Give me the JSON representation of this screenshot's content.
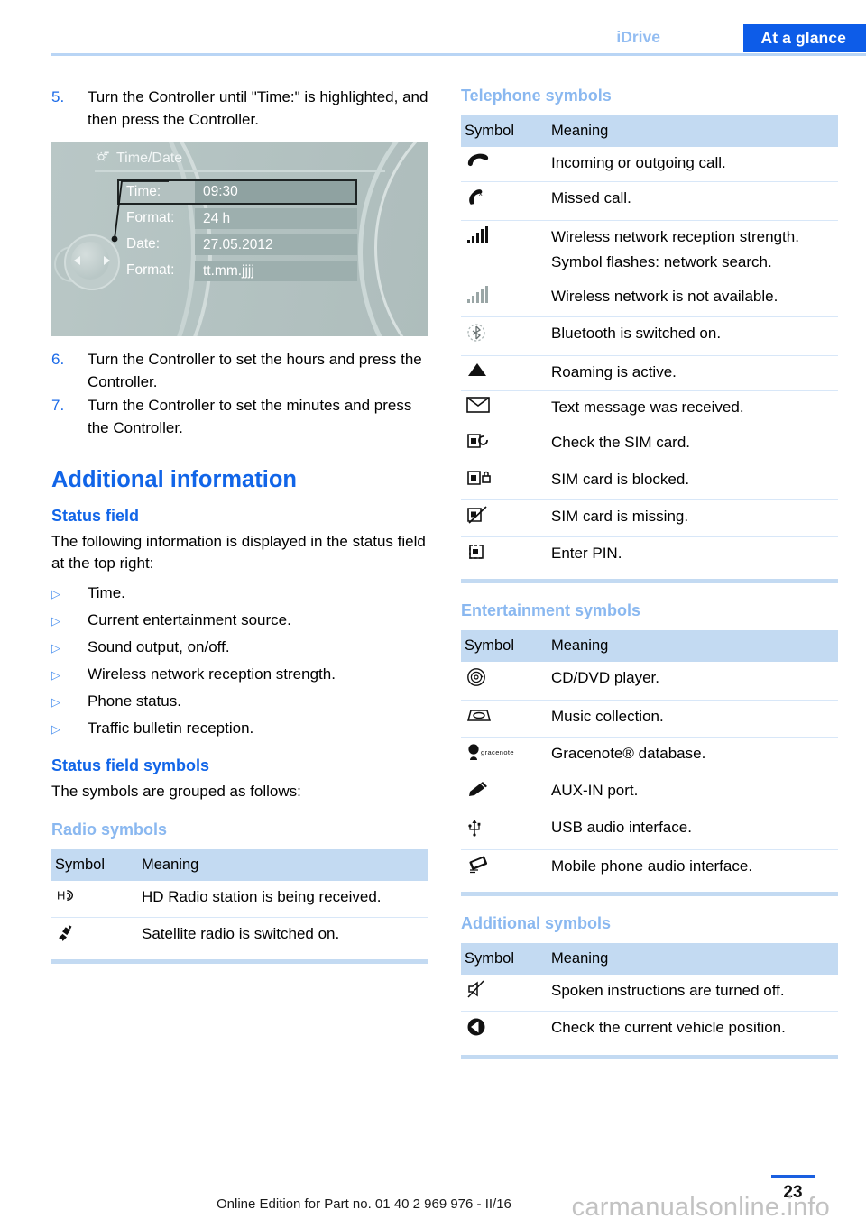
{
  "header": {
    "breadcrumb_chapter": "iDrive",
    "breadcrumb_section": "At a glance"
  },
  "left_column": {
    "steps": [
      {
        "number": "5.",
        "text": "Turn the Controller until \"Time:\" is highlighted, and then press the Controller."
      },
      {
        "number": "6.",
        "text": "Turn the Controller to set the hours and press the Controller."
      },
      {
        "number": "7.",
        "text": "Turn the Controller to set the minutes and press the Controller."
      }
    ],
    "figure": {
      "title": "Time/Date",
      "title_icon": "gear-settings-icon",
      "rows": [
        {
          "label": "Time:",
          "value": "09:30",
          "selected": true
        },
        {
          "label": "Format:",
          "value": "24 h",
          "selected": false
        },
        {
          "label": "Date:",
          "value": "27.05.2012",
          "selected": false
        },
        {
          "label": "Format:",
          "value": "tt.mm.jjjj",
          "selected": false
        }
      ],
      "controller_label": "idrive-controller"
    },
    "section_title": "Additional information",
    "status_field": {
      "heading": "Status field",
      "intro": "The following information is displayed in the status field at the top right:",
      "items": [
        "Time.",
        "Current entertainment source.",
        "Sound output, on/off.",
        "Wireless network reception strength.",
        "Phone status.",
        "Traffic bulletin reception."
      ]
    },
    "status_field_symbols": {
      "heading": "Status field symbols",
      "intro": "The symbols are grouped as follows:"
    },
    "radio_symbols": {
      "heading": "Radio symbols",
      "columns": [
        "Symbol",
        "Meaning"
      ],
      "rows": [
        {
          "symbol": "hd-radio-icon",
          "glyph": "Hʟ",
          "meaning": "HD Radio station is being received."
        },
        {
          "symbol": "satellite-radio-icon",
          "glyph": "✹",
          "meaning": "Satellite radio is switched on."
        }
      ]
    }
  },
  "right_column": {
    "telephone_symbols": {
      "heading": "Telephone symbols",
      "columns": [
        "Symbol",
        "Meaning"
      ],
      "rows": [
        {
          "symbol": "phone-handset-icon",
          "meaning": "Incoming or outgoing call.",
          "meaning_extra": ""
        },
        {
          "symbol": "missed-call-icon",
          "meaning": "Missed call.",
          "meaning_extra": ""
        },
        {
          "symbol": "signal-bars-full-icon",
          "meaning": "Wireless network reception strength.",
          "meaning_extra": "Symbol flashes: network search."
        },
        {
          "symbol": "signal-bars-unavailable-icon",
          "meaning": "Wireless network is not available.",
          "meaning_extra": ""
        },
        {
          "symbol": "bluetooth-icon",
          "meaning": "Bluetooth is switched on.",
          "meaning_extra": ""
        },
        {
          "symbol": "roaming-triangle-icon",
          "meaning": "Roaming is active.",
          "meaning_extra": ""
        },
        {
          "symbol": "envelope-icon",
          "meaning": "Text message was received.",
          "meaning_extra": ""
        },
        {
          "symbol": "sim-check-icon",
          "meaning": "Check the SIM card.",
          "meaning_extra": ""
        },
        {
          "symbol": "sim-locked-icon",
          "meaning": "SIM card is blocked.",
          "meaning_extra": ""
        },
        {
          "symbol": "sim-missing-icon",
          "meaning": "SIM card is missing.",
          "meaning_extra": ""
        },
        {
          "symbol": "sim-pin-icon",
          "meaning": "Enter PIN.",
          "meaning_extra": ""
        }
      ]
    },
    "entertainment_symbols": {
      "heading": "Entertainment symbols",
      "columns": [
        "Symbol",
        "Meaning"
      ],
      "rows": [
        {
          "symbol": "cd-dvd-disc-icon",
          "meaning": "CD/DVD player."
        },
        {
          "symbol": "music-collection-icon",
          "meaning": "Music collection."
        },
        {
          "symbol": "gracenote-icon",
          "label": "gracenote",
          "meaning": "Gracenote® database."
        },
        {
          "symbol": "aux-in-plug-icon",
          "meaning": "AUX-IN port."
        },
        {
          "symbol": "usb-icon",
          "meaning": "USB audio interface."
        },
        {
          "symbol": "mobile-audio-interface-icon",
          "meaning": "Mobile phone audio interface."
        }
      ]
    },
    "additional_symbols": {
      "heading": "Additional symbols",
      "columns": [
        "Symbol",
        "Meaning"
      ],
      "rows": [
        {
          "symbol": "muted-speaker-icon",
          "meaning": "Spoken instructions are turned off."
        },
        {
          "symbol": "vehicle-position-icon",
          "meaning": "Check the current vehicle position."
        }
      ]
    }
  },
  "footer": {
    "edition_text": "Online Edition for Part no. 01 40 2 969 976 - II/16",
    "page_number": "23",
    "watermark": "carmanualsonline.info"
  },
  "colors": {
    "banner_blue": "#0d5ce8",
    "heading_blue": "#1165e8",
    "light_heading_blue": "#8ab8f0",
    "table_header_blue": "#c3daf2",
    "row_rule_blue": "#d8e7f8"
  }
}
